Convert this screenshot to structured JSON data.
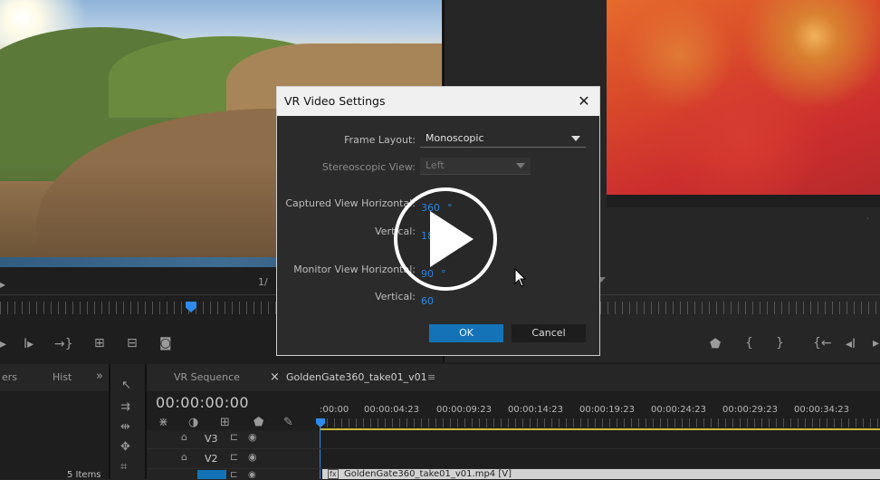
{
  "dialog": {
    "title": "VR Video Settings",
    "close_glyph": "✕",
    "frame_layout_label": "Frame Layout:",
    "frame_layout_value": "Monoscopic",
    "stereo_view_label": "Stereoscopic View:",
    "stereo_view_value": "Left",
    "captured_h_label": "Captured View Horizontal:",
    "captured_h_value": "360",
    "captured_v_label": "Vertical:",
    "captured_v_value": "180",
    "monitor_h_label": "Monitor View Horizontal:",
    "monitor_h_value": "90",
    "monitor_v_label": "Vertical:",
    "monitor_v_value": "60",
    "degree_symbol": "°",
    "ok_label": "OK",
    "cancel_label": "Cancel"
  },
  "source_monitor": {
    "page_fraction": "1/"
  },
  "panels": {
    "left_tab_partial": "ers",
    "left_tab_hist": "Hist",
    "overflow_glyph": "»",
    "items_count": "5 Items"
  },
  "timeline": {
    "tab_vr_sequence": "VR Sequence",
    "tab_close_glyph": "×",
    "tab_golden_gate": "GoldenGate360_take01_v01",
    "tab_menu_glyph": "≡",
    "timecode": "00:00:00:00",
    "ticks": [
      ":00:00",
      "00:00:04:23",
      "00:00:09:23",
      "00:00:14:23",
      "00:00:19:23",
      "00:00:24:23",
      "00:00:29:23",
      "00:00:34:23"
    ],
    "tracks": [
      "V3",
      "V2"
    ],
    "clip_label": "GoldenGate360_take01_v01.mp4 [V]",
    "clip_fx": "fx"
  },
  "icons": {
    "play": "play-icon",
    "cursor": "mouse-cursor-icon"
  },
  "colors": {
    "accent_blue": "#1473b7",
    "value_blue": "#2d8ceb",
    "playhead": "#2d8ceb"
  }
}
